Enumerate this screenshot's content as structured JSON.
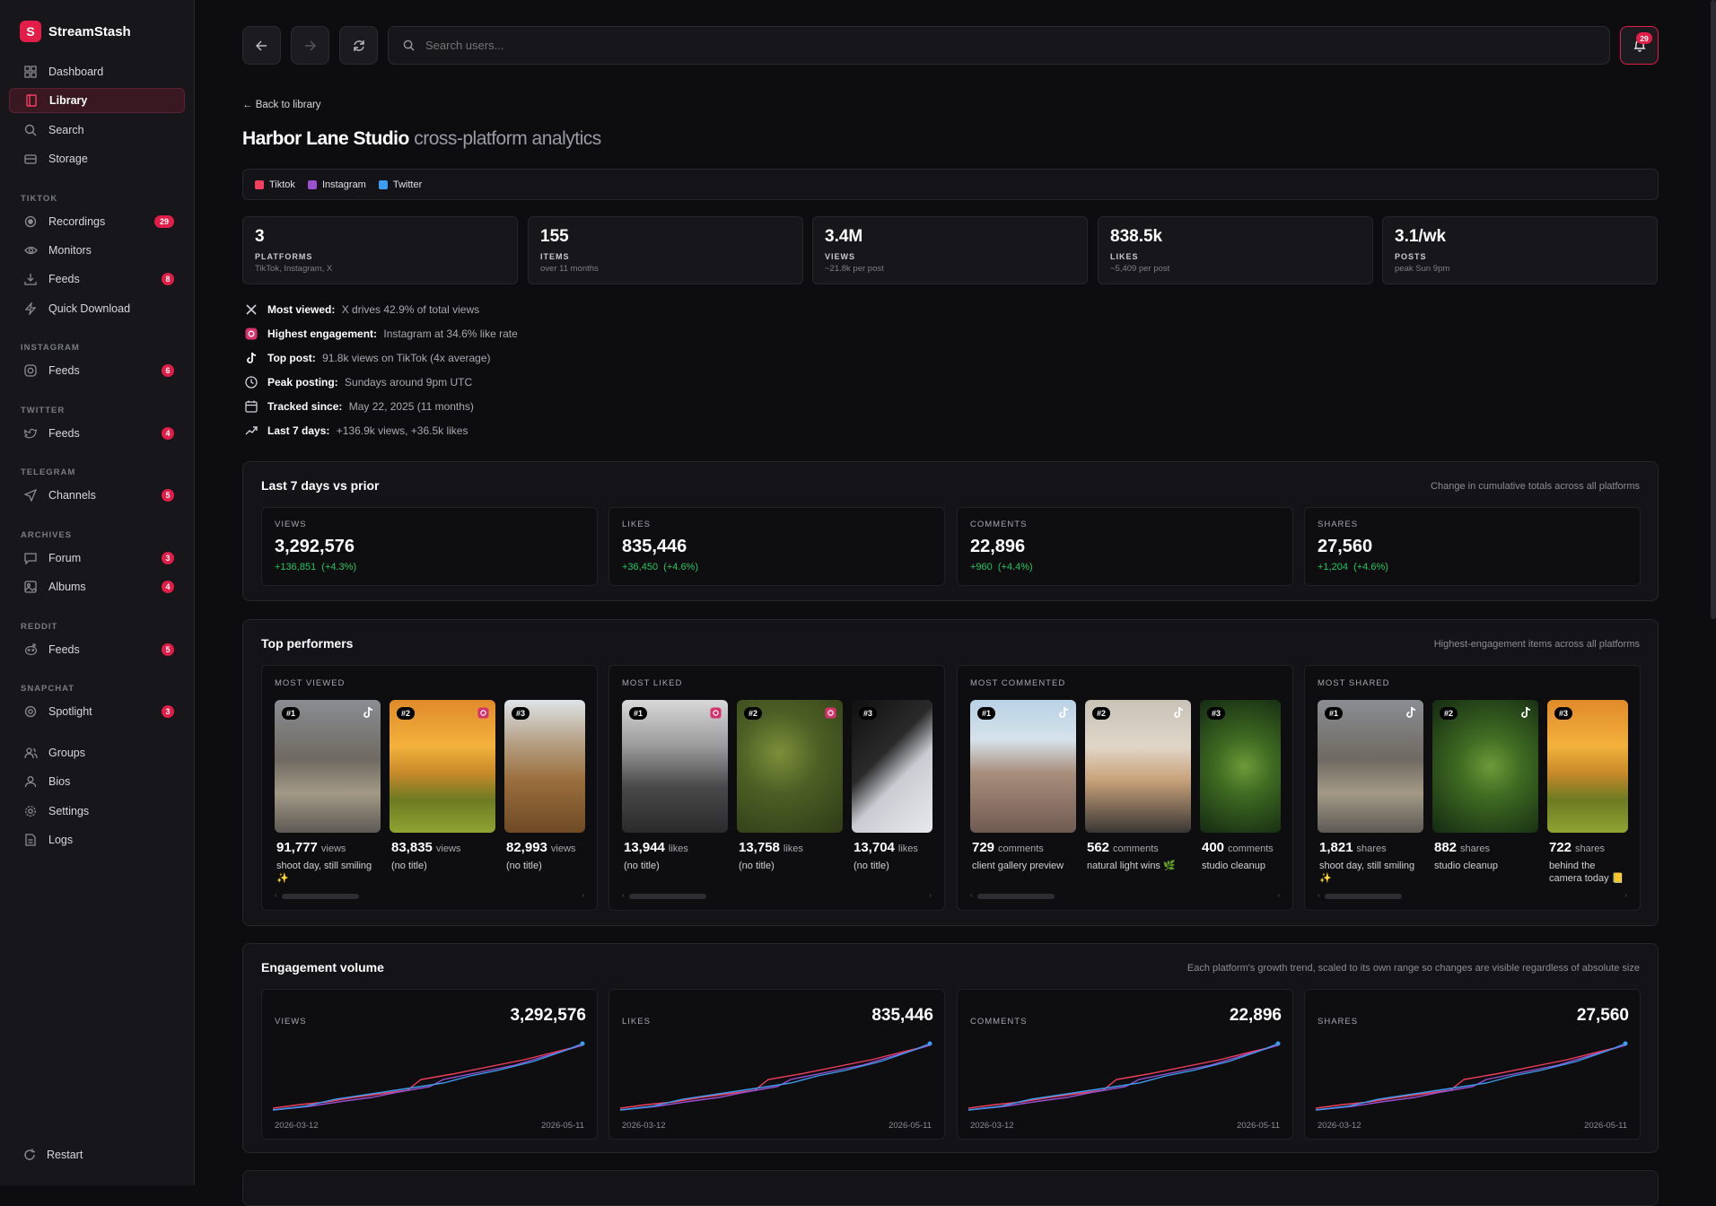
{
  "app": {
    "name": "StreamStash"
  },
  "sidebar": {
    "main": [
      {
        "label": "Dashboard",
        "icon": "grid-icon"
      },
      {
        "label": "Library",
        "icon": "book-icon",
        "active": true
      },
      {
        "label": "Search",
        "icon": "search-icon"
      },
      {
        "label": "Storage",
        "icon": "database-icon"
      }
    ],
    "sections": [
      {
        "title": "TIKTOK",
        "items": [
          {
            "label": "Recordings",
            "badge": "29",
            "icon": "record-icon"
          },
          {
            "label": "Monitors",
            "icon": "eye-icon"
          },
          {
            "label": "Feeds",
            "badge": "8",
            "icon": "download-icon"
          },
          {
            "label": "Quick Download",
            "icon": "bolt-icon"
          }
        ]
      },
      {
        "title": "INSTAGRAM",
        "items": [
          {
            "label": "Feeds",
            "badge": "6",
            "icon": "instagram-icon"
          }
        ]
      },
      {
        "title": "TWITTER",
        "items": [
          {
            "label": "Feeds",
            "badge": "4",
            "icon": "twitter-icon"
          }
        ]
      },
      {
        "title": "TELEGRAM",
        "items": [
          {
            "label": "Channels",
            "badge": "5",
            "icon": "send-icon"
          }
        ]
      },
      {
        "title": "ARCHIVES",
        "items": [
          {
            "label": "Forum",
            "badge": "3",
            "icon": "chat-icon"
          },
          {
            "label": "Albums",
            "badge": "4",
            "icon": "image-icon"
          }
        ]
      },
      {
        "title": "REDDIT",
        "items": [
          {
            "label": "Feeds",
            "badge": "5",
            "icon": "reddit-icon"
          }
        ]
      },
      {
        "title": "SNAPCHAT",
        "items": [
          {
            "label": "Spotlight",
            "badge": "3",
            "icon": "ghost-icon"
          }
        ]
      }
    ],
    "bottom": [
      {
        "label": "Groups",
        "icon": "users-icon"
      },
      {
        "label": "Bios",
        "icon": "user-icon"
      },
      {
        "label": "Settings",
        "icon": "gear-icon"
      },
      {
        "label": "Logs",
        "icon": "file-icon"
      }
    ],
    "restart": "Restart"
  },
  "topbar": {
    "search_placeholder": "Search users...",
    "notifications": "29"
  },
  "page": {
    "back": "← Back to library",
    "title": "Harbor Lane Studio",
    "subtitle": "cross-platform analytics",
    "platforms": [
      {
        "label": "Tiktok",
        "color": "#f43f5e"
      },
      {
        "label": "Instagram",
        "color": "#9b4fd1"
      },
      {
        "label": "Twitter",
        "color": "#3b9cf0"
      }
    ]
  },
  "stats": [
    {
      "value": "3",
      "label": "PLATFORMS",
      "sub": "TikTok, Instagram, X"
    },
    {
      "value": "155",
      "label": "ITEMS",
      "sub": "over 11 months"
    },
    {
      "value": "3.4M",
      "label": "VIEWS",
      "sub": "~21.8k per post"
    },
    {
      "value": "838.5k",
      "label": "LIKES",
      "sub": "~5,409 per post"
    },
    {
      "value": "3.1/wk",
      "label": "POSTS",
      "sub": "peak Sun 9pm"
    }
  ],
  "insights": [
    {
      "icon": "x-icon",
      "label": "Most viewed:",
      "text": "X drives 42.9% of total views"
    },
    {
      "icon": "instagram-icon",
      "label": "Highest engagement:",
      "text": "Instagram at 34.6% like rate"
    },
    {
      "icon": "tiktok-icon",
      "label": "Top post:",
      "text": "91.8k views on TikTok (4x average)"
    },
    {
      "icon": "clock-icon",
      "label": "Peak posting:",
      "text": "Sundays around 9pm UTC"
    },
    {
      "icon": "calendar-icon",
      "label": "Tracked since:",
      "text": "May 22, 2025 (11 months)"
    },
    {
      "icon": "trend-icon",
      "label": "Last 7 days:",
      "text": "+136.9k views, +36.5k likes"
    }
  ],
  "last7": {
    "title": "Last 7 days vs prior",
    "note": "Change in cumulative totals across all platforms",
    "cards": [
      {
        "label": "VIEWS",
        "value": "3,292,576",
        "delta": "+136,851  (+4.3%)"
      },
      {
        "label": "LIKES",
        "value": "835,446",
        "delta": "+36,450  (+4.6%)"
      },
      {
        "label": "COMMENTS",
        "value": "22,896",
        "delta": "+960  (+4.4%)"
      },
      {
        "label": "SHARES",
        "value": "27,560",
        "delta": "+1,204  (+4.6%)"
      }
    ]
  },
  "top": {
    "title": "Top performers",
    "note": "Highest-engagement items across all platforms",
    "columns": [
      {
        "label": "MOST VIEWED",
        "unit": "views",
        "items": [
          {
            "rank": "#1",
            "value": "91,777",
            "caption": "shoot day, still smiling ✨",
            "platform": "tiktok-icon",
            "image": "coyote"
          },
          {
            "rank": "#2",
            "value": "83,835",
            "caption": "(no title)",
            "platform": "instagram-icon",
            "image": "sunset"
          },
          {
            "rank": "#3",
            "value": "82,993",
            "caption": "(no title)",
            "platform": "",
            "image": "hills"
          }
        ]
      },
      {
        "label": "MOST LIKED",
        "unit": "likes",
        "items": [
          {
            "rank": "#1",
            "value": "13,944",
            "caption": "(no title)",
            "platform": "instagram-icon",
            "image": "canyon"
          },
          {
            "rank": "#2",
            "value": "13,758",
            "caption": "(no title)",
            "platform": "instagram-icon",
            "image": "moss"
          },
          {
            "rank": "#3",
            "value": "13,704",
            "caption": "(no title)",
            "platform": "",
            "image": "phone"
          }
        ]
      },
      {
        "label": "MOST COMMENTED",
        "unit": "comments",
        "items": [
          {
            "rank": "#1",
            "value": "729",
            "caption": "client gallery preview",
            "platform": "tiktok-icon",
            "image": "rails"
          },
          {
            "rank": "#2",
            "value": "562",
            "caption": "natural light wins 🌿",
            "platform": "tiktok-icon",
            "image": "beach"
          },
          {
            "rank": "#3",
            "value": "400",
            "caption": "studio cleanup",
            "platform": "",
            "image": "plant"
          }
        ]
      },
      {
        "label": "MOST SHARED",
        "unit": "shares",
        "items": [
          {
            "rank": "#1",
            "value": "1,821",
            "caption": "shoot day, still smiling ✨",
            "platform": "tiktok-icon",
            "image": "coyote"
          },
          {
            "rank": "#2",
            "value": "882",
            "caption": "studio cleanup",
            "platform": "tiktok-icon",
            "image": "plant"
          },
          {
            "rank": "#3",
            "value": "722",
            "caption": "behind the camera today 📒",
            "platform": "",
            "image": "sunset"
          }
        ]
      }
    ]
  },
  "volume": {
    "title": "Engagement volume",
    "note": "Each platform's growth trend, scaled to its own range so changes are visible regardless of absolute size",
    "cards": [
      {
        "label": "VIEWS",
        "value": "3,292,576",
        "start": "2026-03-12",
        "end": "2026-05-11"
      },
      {
        "label": "LIKES",
        "value": "835,446",
        "start": "2026-03-12",
        "end": "2026-05-11"
      },
      {
        "label": "COMMENTS",
        "value": "22,896",
        "start": "2026-03-12",
        "end": "2026-05-11"
      },
      {
        "label": "SHARES",
        "value": "27,560",
        "start": "2026-03-12",
        "end": "2026-05-11"
      }
    ]
  },
  "colors": {
    "accent": "#e11d48",
    "tiktok": "#f43f5e",
    "instagram": "#9b4fd1",
    "twitter": "#3b9cf0",
    "positive": "#22c55e"
  }
}
